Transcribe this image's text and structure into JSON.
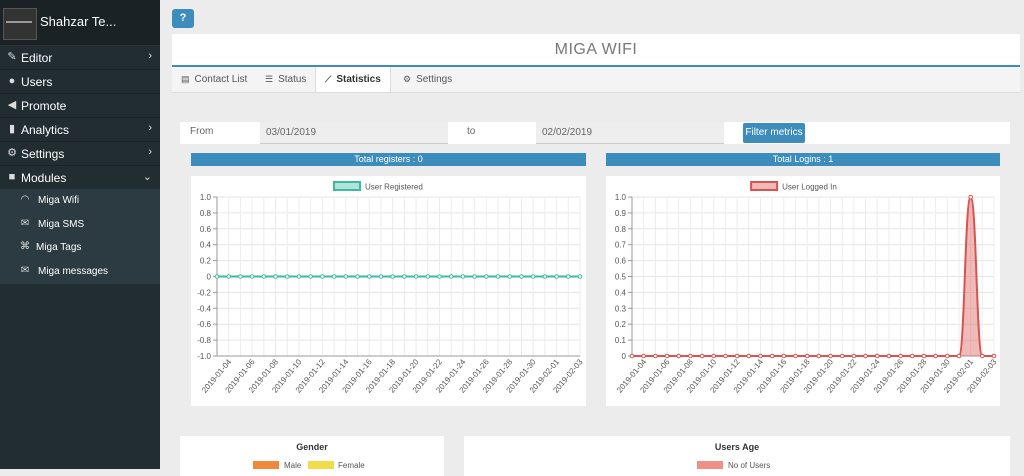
{
  "brand": {
    "name": "Shahzar Te..."
  },
  "sidebar": {
    "items": [
      {
        "label": "Editor",
        "icon": "pencil-icon",
        "chevron": "›"
      },
      {
        "label": "Users",
        "icon": "users-icon",
        "chevron": ""
      },
      {
        "label": "Promote",
        "icon": "bullhorn-icon",
        "chevron": ""
      },
      {
        "label": "Analytics",
        "icon": "bar-chart-icon",
        "chevron": "›"
      },
      {
        "label": "Settings",
        "icon": "wrench-icon",
        "chevron": "›"
      },
      {
        "label": "Modules",
        "icon": "cubes-icon",
        "chevron": "⌄"
      }
    ],
    "subitems": [
      {
        "label": "Miga Wifi",
        "icon": "wifi-icon"
      },
      {
        "label": "Miga SMS",
        "icon": "envelope-icon"
      },
      {
        "label": "Miga Tags",
        "icon": "tags-icon"
      },
      {
        "label": "Miga messages",
        "icon": "envelope-icon"
      }
    ]
  },
  "header": {
    "title": "MIGA WIFI",
    "help_label": "?"
  },
  "tabs": [
    {
      "label": "Contact List",
      "icon": "list-icon"
    },
    {
      "label": "Status",
      "icon": "bars-icon"
    },
    {
      "label": "Statistics",
      "icon": "line-chart-icon"
    },
    {
      "label": "Settings",
      "icon": "cogs-icon"
    }
  ],
  "filter": {
    "from_label": "From",
    "from_value": "03/01/2019",
    "to_label": "to",
    "to_value": "02/02/2019",
    "button_label": "Filter metrics"
  },
  "panels": {
    "registers_title": "Total registers : 0",
    "logins_title": "Total Logins : 1"
  },
  "chart_data": [
    {
      "type": "line",
      "title": "",
      "legend": "User Registered",
      "legend_position": "top-center",
      "series_color": "#3cba9f",
      "ylim": [
        -1.0,
        1.0
      ],
      "yticks": [
        "1.0",
        "0.8",
        "0.6",
        "0.4",
        "0.2",
        "0",
        "-0.2",
        "-0.4",
        "-0.6",
        "-0.8",
        "-1.0"
      ],
      "x_tick_labels": [
        "2019-01-04",
        "2019-01-06",
        "2019-01-08",
        "2019-01-10",
        "2019-01-12",
        "2019-01-14",
        "2019-01-16",
        "2019-01-18",
        "2019-01-20",
        "2019-01-22",
        "2019-01-24",
        "2019-01-26",
        "2019-01-28",
        "2019-01-30",
        "2019-02-01",
        "2019-02-03"
      ],
      "x_start": "2019-01-03",
      "x_end": "2019-02-03",
      "series": [
        {
          "name": "User Registered",
          "values": [
            0,
            0,
            0,
            0,
            0,
            0,
            0,
            0,
            0,
            0,
            0,
            0,
            0,
            0,
            0,
            0,
            0,
            0,
            0,
            0,
            0,
            0,
            0,
            0,
            0,
            0,
            0,
            0,
            0,
            0,
            0,
            0
          ]
        }
      ]
    },
    {
      "type": "area",
      "title": "",
      "legend": "User Logged In",
      "legend_position": "top-center",
      "series_color": "#d9534f",
      "ylim": [
        0,
        1.0
      ],
      "yticks": [
        "1.0",
        "0.9",
        "0.8",
        "0.7",
        "0.6",
        "0.5",
        "0.4",
        "0.3",
        "0.2",
        "0.1",
        "0"
      ],
      "x_tick_labels": [
        "2019-01-04",
        "2019-01-06",
        "2019-01-08",
        "2019-01-10",
        "2019-01-12",
        "2019-01-14",
        "2019-01-16",
        "2019-01-18",
        "2019-01-20",
        "2019-01-22",
        "2019-01-24",
        "2019-01-26",
        "2019-01-28",
        "2019-01-30",
        "2019-02-01",
        "2019-02-03"
      ],
      "x_start": "2019-01-03",
      "x_end": "2019-02-03",
      "series": [
        {
          "name": "User Logged In",
          "values": [
            0,
            0,
            0,
            0,
            0,
            0,
            0,
            0,
            0,
            0,
            0,
            0,
            0,
            0,
            0,
            0,
            0,
            0,
            0,
            0,
            0,
            0,
            0,
            0,
            0,
            0,
            0,
            0,
            0,
            1,
            0,
            0
          ]
        }
      ]
    }
  ],
  "bottom": {
    "gender_title": "Gender",
    "gender_legend": [
      {
        "label": "Male",
        "color": "#f0883a"
      },
      {
        "label": "Female",
        "color": "#f3dc4c"
      }
    ],
    "age_title": "Users Age",
    "age_legend": [
      {
        "label": "No of Users",
        "color": "#ef8f86"
      }
    ]
  }
}
